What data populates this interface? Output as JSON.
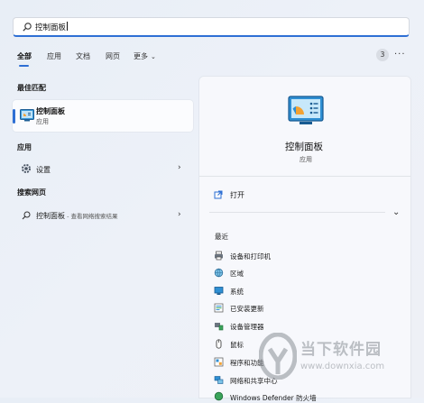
{
  "search": {
    "query": "控制面板"
  },
  "tabs": [
    {
      "label": "全部"
    },
    {
      "label": "应用"
    },
    {
      "label": "文档"
    },
    {
      "label": "网页"
    },
    {
      "label": "更多"
    }
  ],
  "header_right": {
    "count": "3"
  },
  "left": {
    "best_match_header": "最佳匹配",
    "best_match": {
      "title": "控制面板",
      "subtitle": "应用"
    },
    "apps_header": "应用",
    "apps": [
      {
        "label": "设置"
      }
    ],
    "web_header": "搜索网页",
    "web": {
      "label": "控制面板",
      "suffix": " - 查看网络搜索结果"
    }
  },
  "right": {
    "app_title": "控制面板",
    "app_type": "应用",
    "open_label": "打开",
    "recent_header": "最近",
    "recent": [
      {
        "label": "设备和打印机",
        "icon": "printer-icon"
      },
      {
        "label": "区域",
        "icon": "globe-icon"
      },
      {
        "label": "系统",
        "icon": "monitor-icon"
      },
      {
        "label": "已安装更新",
        "icon": "updates-icon"
      },
      {
        "label": "设备管理器",
        "icon": "device-manager-icon"
      },
      {
        "label": "鼠标",
        "icon": "mouse-icon"
      },
      {
        "label": "程序和功能",
        "icon": "programs-icon"
      },
      {
        "label": "网络和共享中心",
        "icon": "network-icon"
      },
      {
        "label": "Windows Defender 防火墙",
        "icon": "firewall-icon"
      }
    ]
  },
  "watermark": {
    "title": "当下软件园",
    "url": "www.downxia.com"
  },
  "colors": {
    "accent": "#2e6fd4"
  }
}
